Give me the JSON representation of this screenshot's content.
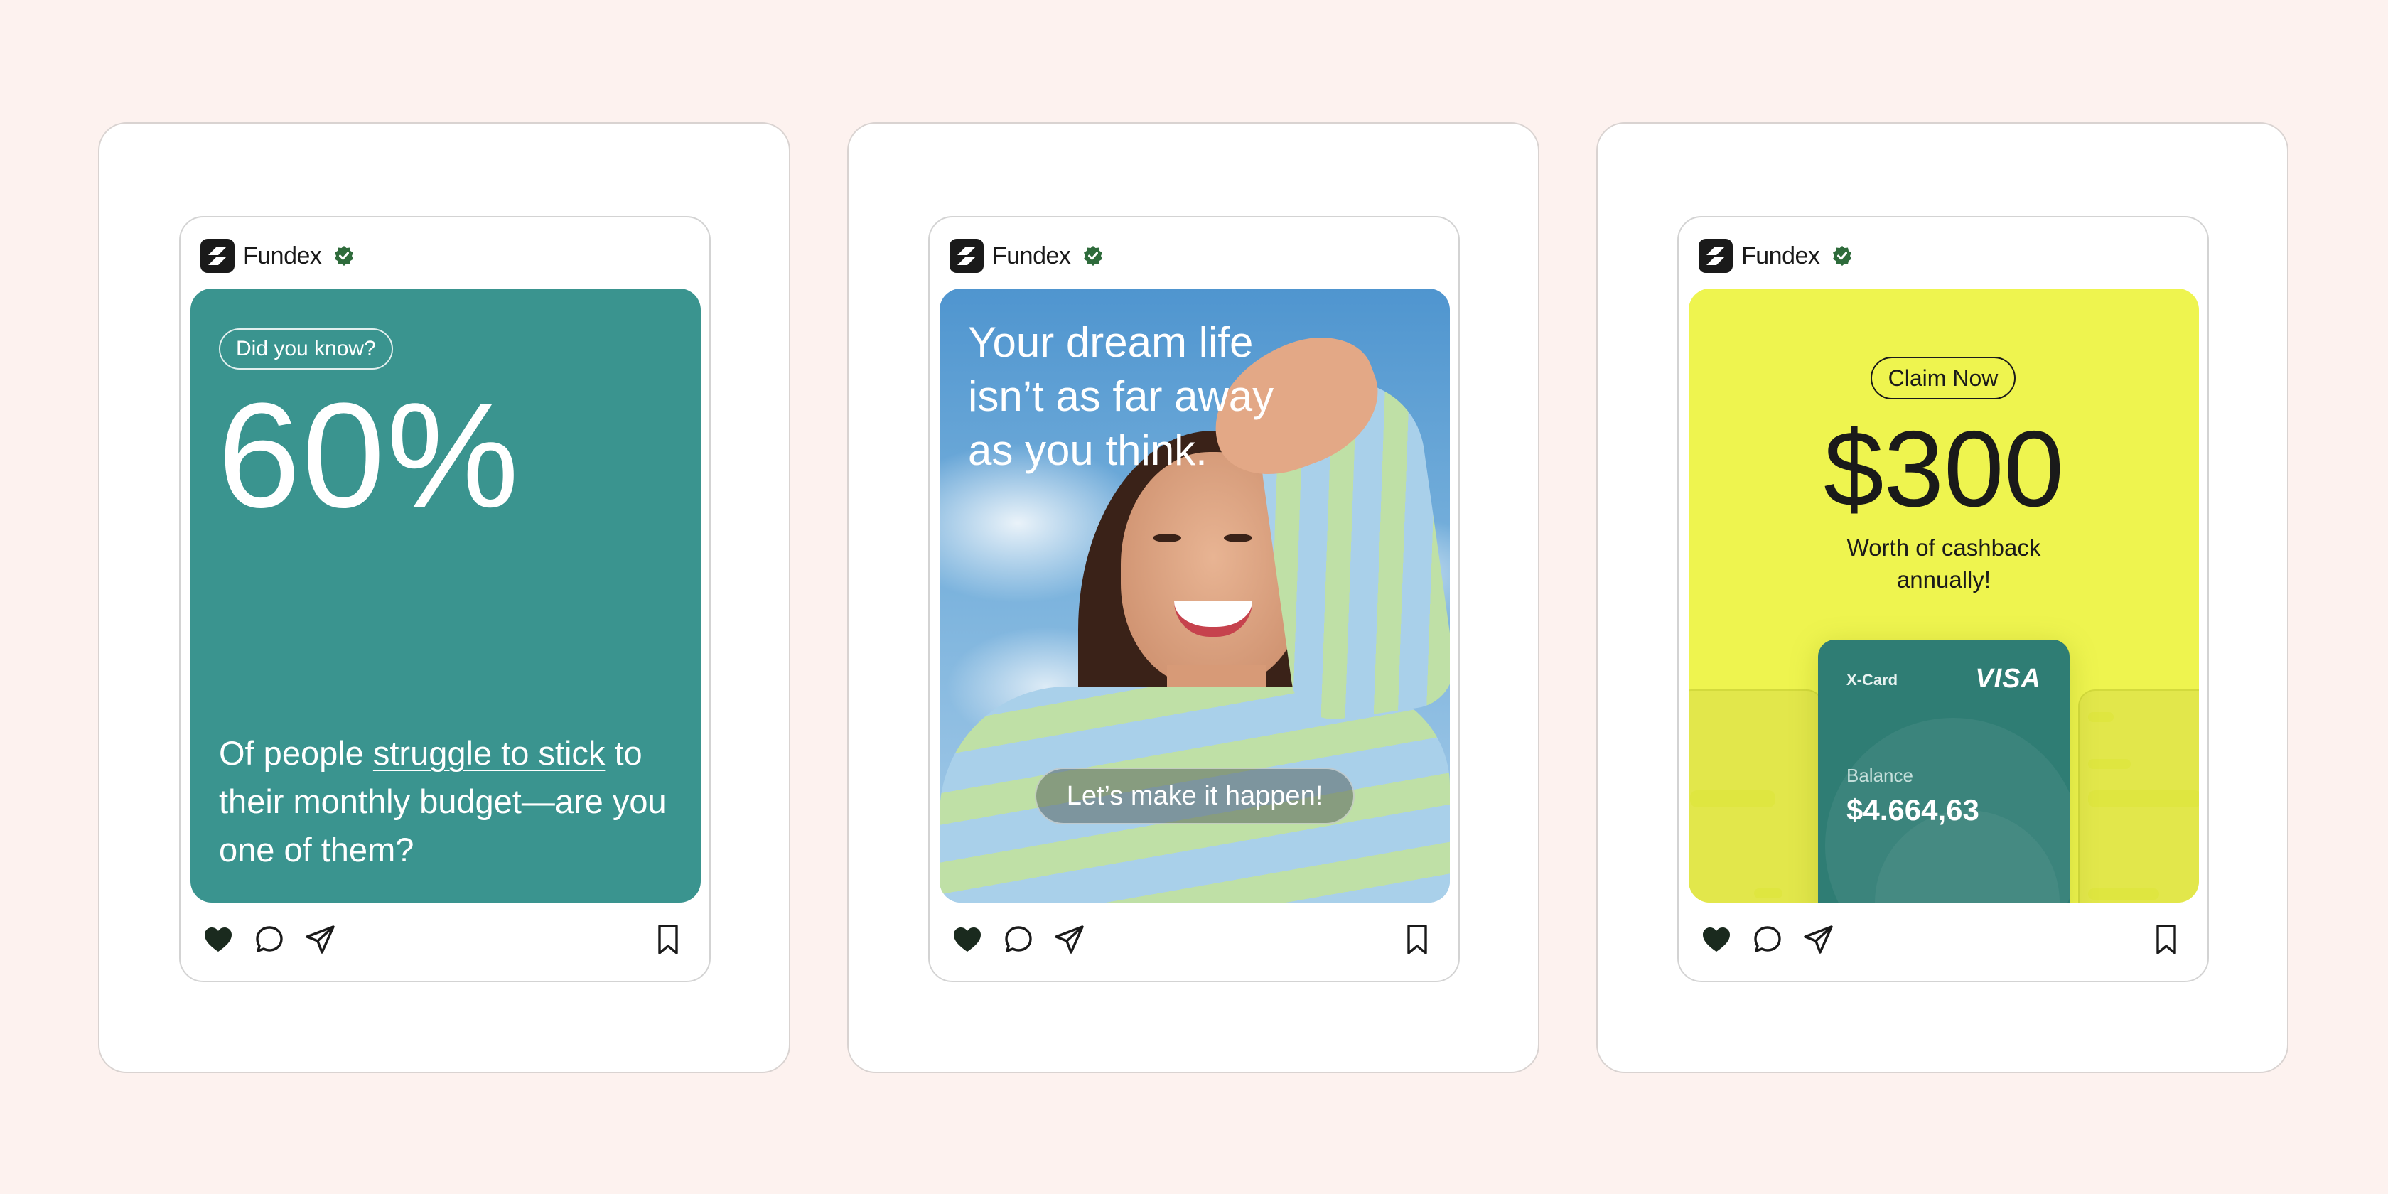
{
  "brand": {
    "name": "Fundex",
    "verified_icon": "verified-badge-icon",
    "logo_icon": "fundex-logo-icon"
  },
  "colors": {
    "background": "#fdf2ef",
    "teal_card": "#3a948f",
    "yellow_card": "#eef44f",
    "xcard": "#2f7d74",
    "verified": "#2e6b3b"
  },
  "posts": [
    {
      "pill": "Did you know?",
      "stat": "60%",
      "caption_pre": "Of people ",
      "caption_underlined": "struggle to stick",
      "caption_post": " to their monthly budget—are you one of them?"
    },
    {
      "headline": "Your dream life isn’t as far away as you think.",
      "cta": "Let’s make it happen!"
    },
    {
      "cta": "Claim Now",
      "amount": "$300",
      "subtitle": "Worth of cashback annually!",
      "card": {
        "name": "X-Card",
        "network": "VISA",
        "balance_label": "Balance",
        "balance_value": "$4.664,63"
      }
    }
  ],
  "actions": [
    "heart-icon",
    "comment-icon",
    "share-icon",
    "bookmark-icon"
  ]
}
